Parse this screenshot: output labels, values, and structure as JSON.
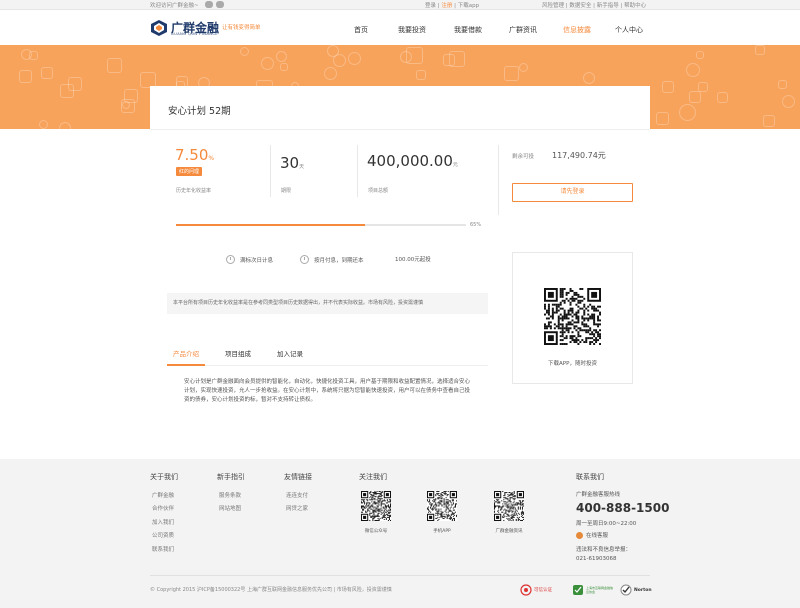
{
  "topbar": {
    "welcome": "欢迎访问广群金融~",
    "login": "登录",
    "register": "注册",
    "download": "下载app",
    "sep": "|",
    "risk": "风险管理",
    "security": "数据安全",
    "guide": "新手指导",
    "help": "帮助中心"
  },
  "logo": {
    "cn": "广群金融",
    "en": "GUANG QUN FINANCE",
    "slogan": "让有钱变得简单"
  },
  "nav": [
    "首页",
    "我要投资",
    "我要借款",
    "广群资讯",
    "信息披露",
    "个人中心"
  ],
  "nav_active_index": 4,
  "plan": {
    "title": "安心计划 52期",
    "rate": "7.50",
    "rate_unit": "%",
    "badge": "红的问理",
    "rate_label": "历史年化收益率",
    "term": "30",
    "term_unit": "天",
    "term_label": "期限",
    "amount": "400,000.00",
    "amount_unit": "元",
    "amount_label": "项目总额",
    "remain_label": "剩余可投",
    "remain_value": "117,490.74元",
    "login_button": "请先登录",
    "progress": 0.65,
    "progress_text": "65%",
    "feature1": "满标次日计息",
    "feature2": "按月付息，到期还本",
    "feature3": "100.00元起投",
    "notice": "本平台所有项目历史年化收益率是在参考同类型项目历史数据得出，并不代表实际收益。市场有风险，投资需谨慎",
    "qr_caption": "下载APP，随时投资"
  },
  "tabs": [
    "产品介绍",
    "项目组成",
    "加入记录"
  ],
  "tab_active_index": 0,
  "description": "安心计划是广群金融面向会员提供的智能化，自动化，快捷化投资工具，用户基于期限和收益配置情况，选择适合安心计划，实现快速投资，允人一步抢收益。在安心计划中，系统将只据为您智能快速投资，用户可以在债务中查看自己投资的债券，安心计划投资的标，暂对不支持转让债权。",
  "footer": {
    "about": {
      "title": "关于我们",
      "links": [
        "广群金融",
        "合作伙伴",
        "加入我们",
        "公司资质",
        "联系我们"
      ]
    },
    "guide": {
      "title": "新手指引",
      "links": [
        "服务条款",
        "网站地图"
      ]
    },
    "friends": {
      "title": "友情链接",
      "links": [
        "连连支付",
        "网贷之家"
      ]
    },
    "follow": {
      "title": "关注我们",
      "qrs": [
        "微信公众号",
        "手机APP",
        "广群金融资讯"
      ]
    },
    "contact": {
      "title": "联系我们",
      "hotline_label": "广群金融客服热线",
      "hotline": "400-888-1500",
      "hours": "周一至周日9:00~22:00",
      "online": "在线客服",
      "report_label": "违法和不良信息举报：",
      "report_phone": "021-61903068"
    },
    "copyright": "© Copyright 2015 沪ICP备15000322号 上海广群互联网金融信息服务优先公司 | 市场有风险，投资需谨慎",
    "trust1": "可信认证",
    "trust2": "上海市互联网金融信息协会",
    "trust3": "Norton"
  },
  "colors": {
    "accent": "#f58a3c",
    "banner": "#f8a35c",
    "navy": "#1f3a6b"
  }
}
